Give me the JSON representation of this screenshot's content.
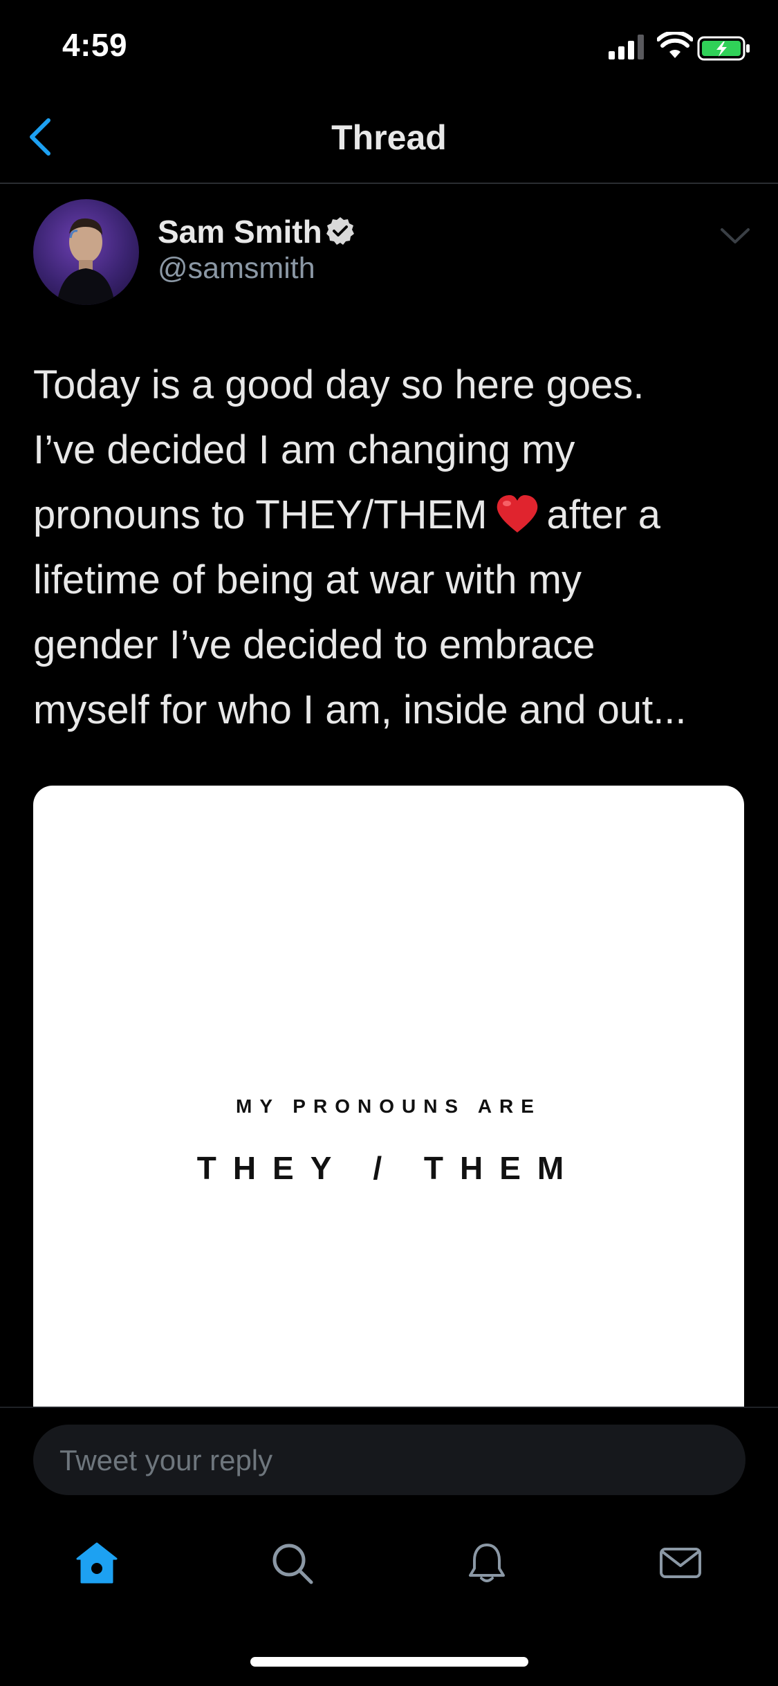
{
  "status_bar": {
    "time": "4:59"
  },
  "nav": {
    "title": "Thread"
  },
  "tweet": {
    "display_name": "Sam Smith",
    "handle": "@samsmith",
    "text_lines": [
      "Today is a good day so here goes.",
      "I’ve decided I am changing my",
      "pronouns to THEY/THEM",
      "after a",
      "lifetime of being at war with my",
      "gender I’ve decided to embrace",
      "myself for who I am, inside and out..."
    ],
    "media": {
      "line1": "MY PRONOUNS ARE",
      "line2": "THEY / THEM"
    }
  },
  "composer": {
    "placeholder": "Tweet your reply"
  },
  "colors": {
    "accent": "#1da1f2",
    "background": "#000000",
    "text_primary": "#e8e8e8",
    "text_secondary": "#8b98a5",
    "heart": "#e0242e"
  },
  "icons": {
    "back": "chevron-left-icon",
    "verified": "verified-badge-icon",
    "caret": "chevron-down-icon",
    "home": "home-icon",
    "search": "search-icon",
    "notifications": "bell-icon",
    "messages": "mail-icon"
  }
}
